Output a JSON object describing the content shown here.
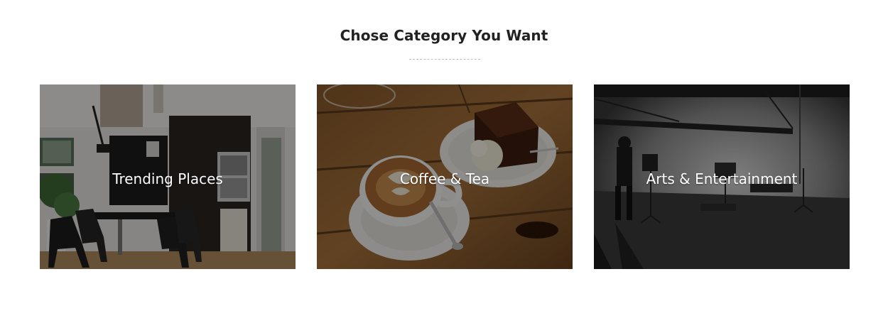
{
  "section": {
    "title": "Chose Category You Want"
  },
  "categories": [
    {
      "label": "Trending Places",
      "image": "interior-dining-room-image"
    },
    {
      "label": "Coffee & Tea",
      "image": "coffee-and-cake-image"
    },
    {
      "label": "Arts & Entertainment",
      "image": "photo-studio-image"
    }
  ]
}
